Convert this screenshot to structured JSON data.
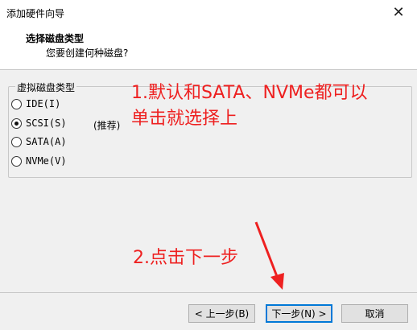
{
  "window": {
    "title": "添加硬件向导",
    "close_glyph": "✕"
  },
  "header": {
    "title": "选择磁盘类型",
    "subtitle": "您要创建何种磁盘?"
  },
  "group": {
    "legend": "虚拟磁盘类型",
    "options": [
      {
        "label": "IDE(I)",
        "checked": false
      },
      {
        "label": "SCSI(S)",
        "checked": true
      },
      {
        "label": "SATA(A)",
        "checked": false
      },
      {
        "label": "NVMe(V)",
        "checked": false
      }
    ],
    "recommend": "(推荐)"
  },
  "annotations": {
    "line1": "1.默认和SATA、NVMe都可以",
    "line2": "单击就选择上",
    "step2": "2.点击下一步",
    "color": "#ee2020"
  },
  "buttons": {
    "back": "< 上一步(B)",
    "next": "下一步(N) >",
    "cancel": "取消"
  }
}
